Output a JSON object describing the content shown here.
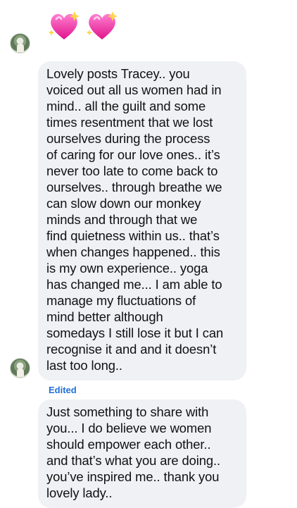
{
  "reaction": {
    "emoji_count": 2,
    "icon": "sparkling-heart"
  },
  "messages": [
    {
      "lines": [
        "Lovely posts Tracey.. you",
        "voiced out all us women had in",
        "mind.. all the guilt and some",
        "times resentment that we lost",
        "ourselves during the process",
        "of caring for our love ones.. it’s",
        "never too late to come back to",
        "ourselves.. through breathe we",
        "can slow down our monkey",
        "minds and through that we",
        "find quietness within us.. that’s",
        "when changes happened.. this",
        "is my own experience.. yoga",
        "has changed me... I am able to",
        "manage my fluctuations of",
        "mind better although",
        "somedays I still lose it but I can",
        "recognise it and and it doesn’t",
        "last too long.."
      ]
    },
    {
      "lines": [
        "Just something to share with",
        "you... I do believe we women",
        "should empower each other..",
        "and that’s what you are doing..",
        "you’ve inspired me.. thank you",
        "lovely lady.."
      ]
    }
  ],
  "status": {
    "edited_label": "Edited"
  },
  "colors": {
    "bubble_bg": "#f0f1f5",
    "edited_text": "#1f6fd6",
    "text": "#111111"
  }
}
